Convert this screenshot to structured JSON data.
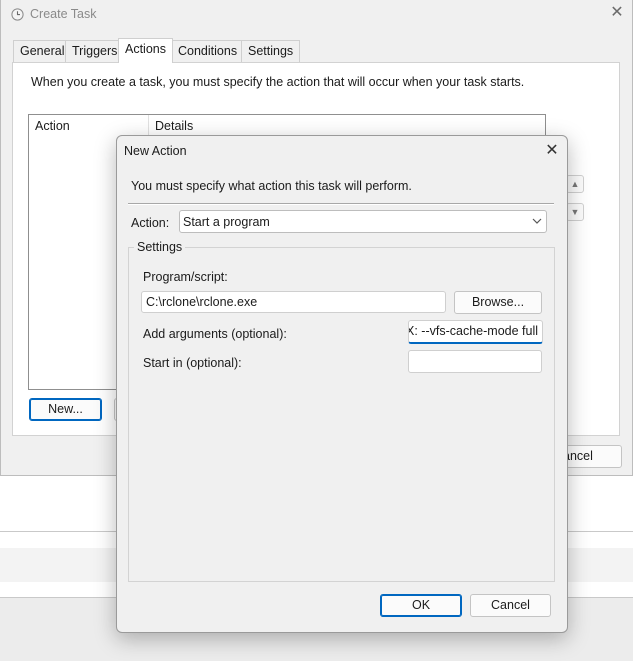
{
  "create_task": {
    "title": "Create Task",
    "tabs": [
      {
        "label": "General",
        "active": false
      },
      {
        "label": "Triggers",
        "active": false
      },
      {
        "label": "Actions",
        "active": true
      },
      {
        "label": "Conditions",
        "active": false
      },
      {
        "label": "Settings",
        "active": false
      }
    ],
    "description": "When you create a task, you must specify the action that will occur when your task starts.",
    "columns": [
      "Action",
      "Details"
    ],
    "new_button": "New...",
    "cancel_button_partial": "ancel"
  },
  "new_action": {
    "title": "New Action",
    "description": "You must specify what action this task will perform.",
    "action_label": "Action:",
    "action_value": "Start a program",
    "settings_legend": "Settings",
    "program_label": "Program/script:",
    "program_value": "C:\\rclone\\rclone.exe",
    "browse_button": "Browse...",
    "args_label": "Add arguments (optional):",
    "args_value": "X: --vfs-cache-mode full",
    "startin_label": "Start in (optional):",
    "startin_value": "",
    "ok_button": "OK",
    "cancel_button": "Cancel"
  },
  "icons": {
    "window_icon": "clock-icon",
    "close": "close-icon",
    "dropdown": "chevron-down-icon"
  }
}
